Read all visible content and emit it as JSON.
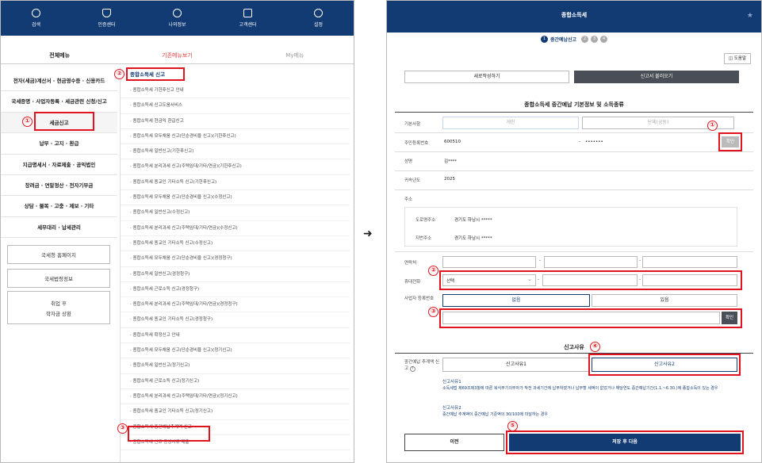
{
  "left": {
    "topnav": [
      {
        "label": "검색",
        "icon": "search-icon"
      },
      {
        "label": "인증센터",
        "icon": "shield-icon"
      },
      {
        "label": "나의정보",
        "icon": "person-icon"
      },
      {
        "label": "고객센터",
        "icon": "speaker-icon"
      },
      {
        "label": "설정",
        "icon": "gear-icon"
      }
    ],
    "tabs": [
      "전체메뉴",
      "기존메뉴보기",
      "My메뉴"
    ],
    "menu": [
      "전자(세금)계산서 · 현금영수증 · 신용카드",
      "국세증명 · 사업자등록 · 세금관련 신청/신고",
      "세금신고",
      "납부 · 고지 · 환급",
      "지급명세서 · 자료제출 · 공익법인",
      "장려금 · 연말정산 · 전자기부금",
      "상담 · 불복 · 고충 · 제보 · 기타",
      "세무대리 · 납세관리"
    ],
    "buttons": [
      "국세청 홈페이지",
      "국세법령정보"
    ],
    "job": [
      "취업 후",
      "학자금 상환"
    ],
    "submenu_title": "종합소득세 신고",
    "submenu": [
      "· 종합소득세 기한후신고 안내",
      "· 종합소득세 신고도움서비스",
      "· 종합소득세 현금익 환급신고",
      "· 종합소득세 모두채움 신고(단순경비율 신고)(기한후신고)",
      "· 종합소득세 일반신고(기한후신고)",
      "· 종합소득세 분리과세 신고(주택임대/기타/연금)(기한후신고)",
      "· 종합소득세 종교인 기타소득 신고(기한후신고)",
      "· 종합소득세 모두채움 신고(단순경비율 신고)(수정신고)",
      "· 종합소득세 일반신고(수정신고)",
      "· 종합소득세 분리과세 신고(주택임대/기타/연금)(수정신고)",
      "· 종합소득세 종교인 기타소득 신고(수정신고)",
      "· 종합소득세 모두채움 신고(단순경비율 신고)(경정청구)",
      "· 종합소득세 일반신고(경정청구)",
      "· 종합소득세 근로소득 신고(경정청구)",
      "· 종합소득세 분리과세 신고(주택임대/기타/연금)(경정청구)",
      "· 종합소득세 종교인 기타소득 신고(경정청구)",
      "· 종합소득세 확정신고 안내",
      "· 종합소득세 모두채움 신고(단순경비율 신고)(정기신고)",
      "· 종합소득세 일반신고(정기신고)",
      "· 종합소득세 근로소득 신고(정기신고)",
      "· 종합소득세 분리과세 신고(주택임대/기타/연금)(정기신고)",
      "· 종합소득세 종교인 기타소득 신고(정기신고)",
      "· 종합소득세 중간예납추계액 신고",
      "· 종합소득세 신고 증빙서류 제출"
    ]
  },
  "arrow": "➜",
  "markers": [
    "①",
    "②",
    "③",
    "④",
    "⑤"
  ],
  "right": {
    "header": "종합소득세",
    "step_label": "중간예납신고",
    "steps": [
      "1",
      "2",
      "3",
      "4"
    ],
    "help": "도움말",
    "mode_tabs": [
      "새로작성하기",
      "신고서 불러오기"
    ],
    "section_title": "종합소득세 중간예납 기본정보 및 소득종류",
    "basic": {
      "label": "기본사항",
      "options": [
        "개인",
        "단체(공동)"
      ],
      "rrn_label": "주민등록번호",
      "rrn_front": "600510",
      "rrn_sep": "-",
      "rrn_back": "•••••••",
      "confirm": "확인",
      "name_label": "성명",
      "name": "김****",
      "year_label": "귀속년도",
      "year": "2025",
      "addr_label": "주소",
      "road_label": "도로명주소",
      "road": "경기도 하남시 *****",
      "lot_label": "지번주소",
      "lot": "경기도 하남시 *****"
    },
    "contact": {
      "phone_label": "연락처",
      "mobile_label": "휴대전화",
      "select": "선택",
      "sep": "-"
    },
    "bizno": {
      "label": "사업자 등록번호",
      "options": [
        "없음",
        "있음"
      ],
      "confirm": "확인"
    },
    "reason": {
      "title": "신고사유",
      "label": "중간예납 추계액 신고",
      "help_icon": "?",
      "options": [
        "신고사유1",
        "신고사유2"
      ],
      "desc1_title": "신고사유1",
      "desc1": "소득세법 제69조제3항에 따른 복식부기의무자가 작전 과세기간에 납부하였거나 납부할 세액이 없었거나 해당연도 중간예납기간(1.1.~6.30.)에 종합소득이 있는 경우",
      "desc2_title": "신고사유2",
      "desc2": "중간예납 추계액이 중간예납 기준액의 30/100에 미달하는 경우"
    },
    "buttons": {
      "prev": "이전",
      "next": "저장 후 다음"
    }
  }
}
